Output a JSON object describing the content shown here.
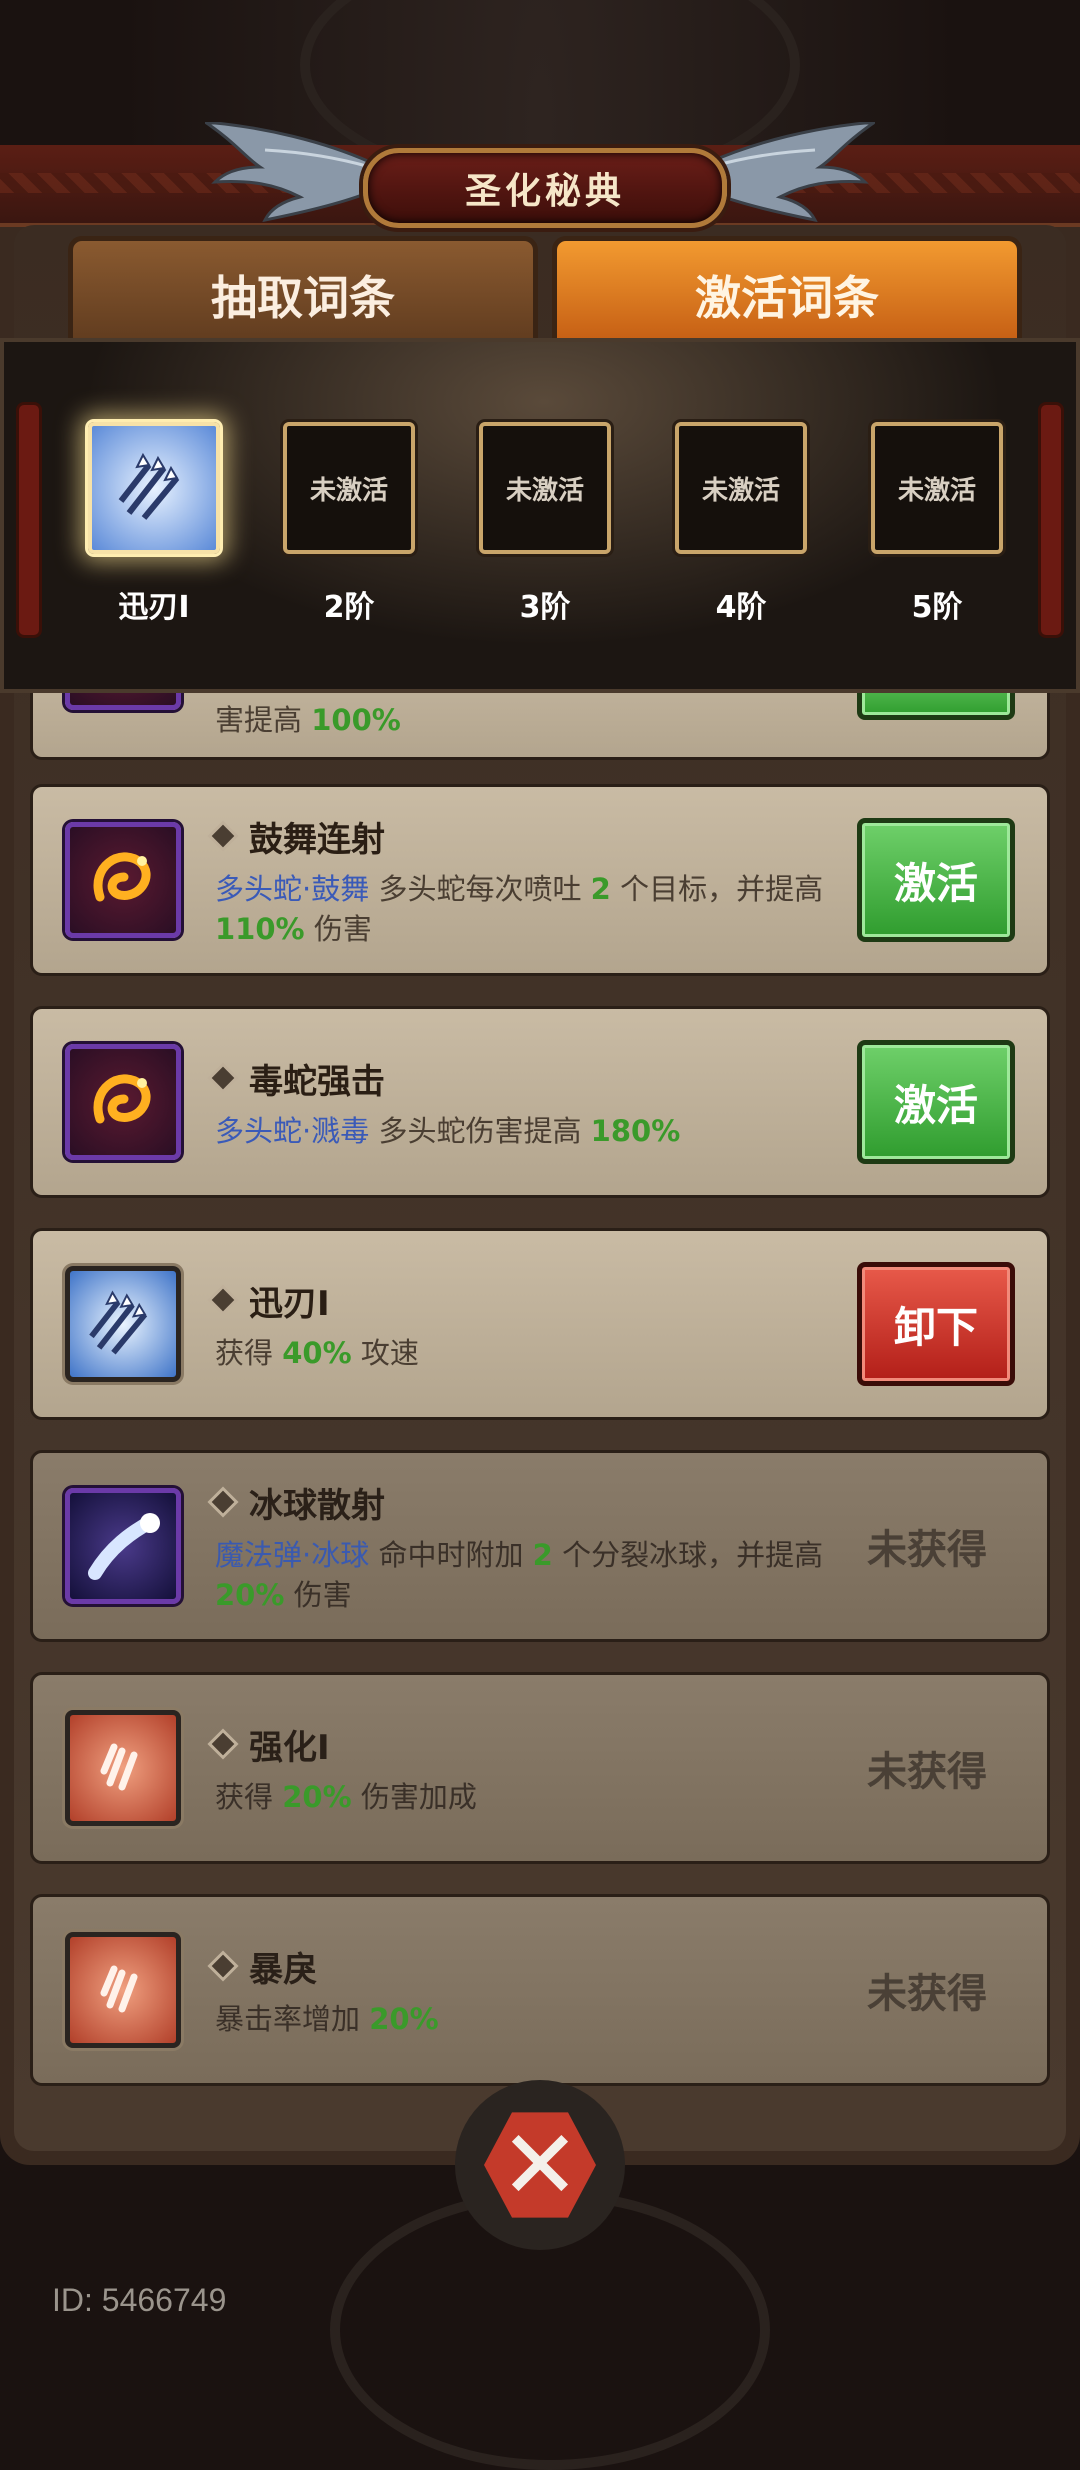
{
  "title": "圣化秘典",
  "tabs": [
    {
      "label": "抽取词条",
      "active": false
    },
    {
      "label": "激活词条",
      "active": true
    }
  ],
  "tiers": [
    {
      "label": "迅刃I",
      "inner": "",
      "activated": true,
      "icon": "arrow-burst-icon"
    },
    {
      "label": "2阶",
      "inner": "未激活",
      "activated": false
    },
    {
      "label": "3阶",
      "inner": "未激活",
      "activated": false
    },
    {
      "label": "4阶",
      "inner": "未激活",
      "activated": false
    },
    {
      "label": "5阶",
      "inner": "未激活",
      "activated": false
    }
  ],
  "partial_card": {
    "desc_text": "害提高",
    "desc_num": "100%"
  },
  "cards": [
    {
      "name": "鼓舞连射",
      "icon": "fire-dragon-icon",
      "tag": "多头蛇·鼓舞",
      "desc_pre": "多头蛇每次喷吐",
      "num1": "2",
      "desc_mid": "个目标，并提高",
      "num2": "110%",
      "desc_post": "伤害",
      "button": "激活"
    },
    {
      "name": "毒蛇强击",
      "icon": "fire-dragon-icon",
      "tag": "多头蛇·溅毒",
      "desc_pre": "多头蛇伤害提高",
      "num1": "180%",
      "button": "激活"
    },
    {
      "name": "迅刃I",
      "icon": "arrow-burst-icon",
      "desc_pre": "获得",
      "num1": "40%",
      "desc_mid": "攻速",
      "button": "卸下"
    },
    {
      "name": "冰球散射",
      "icon": "ice-orb-icon",
      "tag": "魔法弹·冰球",
      "desc_pre": "命中时附加",
      "num1": "2",
      "desc_mid": "个分裂冰球，并提高",
      "num2": "20%",
      "desc_post": "伤害",
      "status": "未获得"
    },
    {
      "name": "强化I",
      "icon": "claw-icon",
      "desc_pre": "获得",
      "num1": "20%",
      "desc_mid": "伤害加成",
      "status": "未获得"
    },
    {
      "name": "暴戾",
      "icon": "claw-icon",
      "desc_pre": "暴击率增加",
      "num1": "20%",
      "status": "未获得"
    }
  ],
  "footer": {
    "id_text": "ID: 5466749"
  },
  "colors": {
    "green_number": "#3a9a2a",
    "blue_tag": "#3a5ab8",
    "active_tab": "#e07a22",
    "green_button": "#3fae3c",
    "red_button": "#c8302a"
  }
}
